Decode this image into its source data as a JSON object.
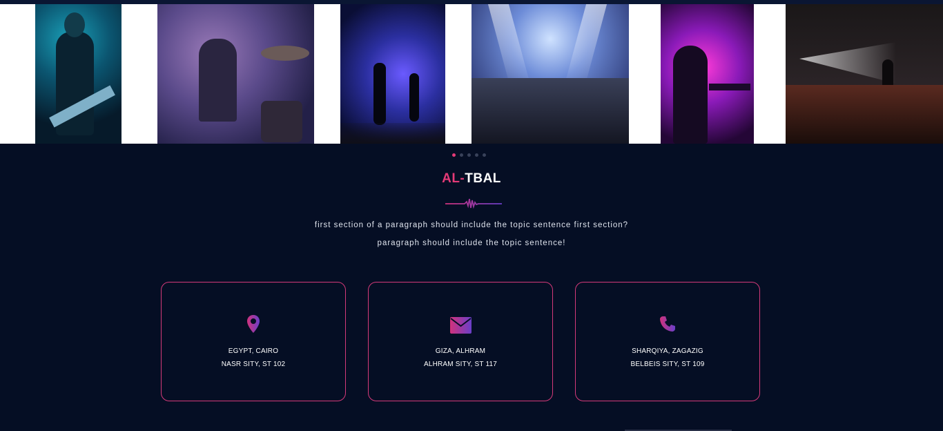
{
  "gallery": {
    "photos": [
      {
        "name": "guitarist-blue-light"
      },
      {
        "name": "drummer-smoke"
      },
      {
        "name": "stage-blue-band"
      },
      {
        "name": "concert-crowd-lights"
      },
      {
        "name": "keyboardist-purple"
      },
      {
        "name": "stage-spotlight-crowd"
      }
    ],
    "active_dot": 0,
    "dot_count": 5
  },
  "brand": {
    "accent": "AL-",
    "rest": "TBAL"
  },
  "intro": {
    "line1": "first section of a paragraph should include the topic sentence first section?",
    "line2": "paragraph should include the topic sentence!"
  },
  "contacts": [
    {
      "icon": "map-pin-icon",
      "line1": "EGYPT, CAIRO",
      "line2": "NASR SITY, ST 102"
    },
    {
      "icon": "envelope-icon",
      "line1": "GIZA, ALHRAM",
      "line2": "ALHRAM SITY, ST 117"
    },
    {
      "icon": "phone-icon",
      "line1": "SHARQIYA, ZAGAZIG",
      "line2": "BELBEIS SITY, ST 109"
    }
  ],
  "colors": {
    "background": "#050e24",
    "accent": "#e43a77",
    "icon_gradient": [
      "#d0327c",
      "#6a3fc9"
    ]
  }
}
